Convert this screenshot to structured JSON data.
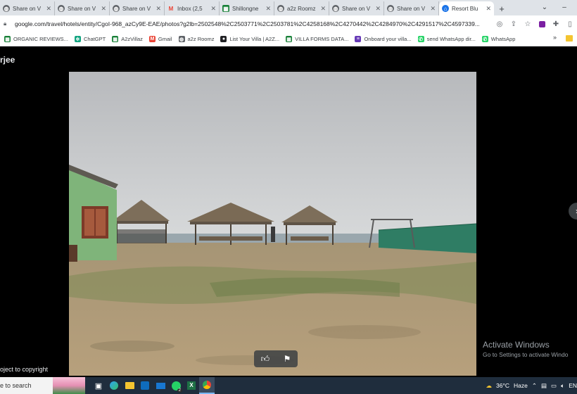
{
  "browser": {
    "tabs": [
      {
        "title": "Share on V",
        "icon": "globe-icon",
        "active": false
      },
      {
        "title": "Share on V",
        "icon": "globe-icon",
        "active": false
      },
      {
        "title": "Share on V",
        "icon": "globe-icon",
        "active": false
      },
      {
        "title": "Inbox (2,5",
        "icon": "gmail-icon",
        "active": false
      },
      {
        "title": "Shillongne",
        "icon": "sheets-icon",
        "active": false
      },
      {
        "title": "a2z Roomz",
        "icon": "globe-icon",
        "active": false
      },
      {
        "title": "Share on V",
        "icon": "globe-icon",
        "active": false
      },
      {
        "title": "Share on V",
        "icon": "globe-icon",
        "active": false
      },
      {
        "title": "Resort Blu",
        "icon": "hotel-icon",
        "active": true
      }
    ],
    "new_tab": "+",
    "url": "google.com/travel/hotels/entity/CgoI-968_azCy9E-EAE/photos?g2lb=2502548%2C2503771%2C2503781%2C4258168%2C4270442%2C4284970%2C4291517%2C4597339...",
    "bookmarks": [
      {
        "label": "ORGANIC REVIEWS...",
        "icon": "sheets-icon",
        "color": "#188038"
      },
      {
        "label": "ChatGPT",
        "icon": "chatgpt-icon",
        "color": "#10a37f"
      },
      {
        "label": "A2zVillaz",
        "icon": "sheets-icon",
        "color": "#188038"
      },
      {
        "label": "Gmail",
        "icon": "gmail-icon",
        "color": "#ea4335"
      },
      {
        "label": "a2z Roomz",
        "icon": "globe-icon",
        "color": "#5f6368"
      },
      {
        "label": "List Your Villa | A2Z...",
        "icon": "circle-icon",
        "color": "#202124"
      },
      {
        "label": "VILLA FORMS DATA...",
        "icon": "sheets-icon",
        "color": "#188038"
      },
      {
        "label": "Onboard your villa...",
        "icon": "forms-icon",
        "color": "#673ab7"
      },
      {
        "label": "send WhatsApp dir...",
        "icon": "whatsapp-icon",
        "color": "#25d366"
      },
      {
        "label": "WhatsApp",
        "icon": "whatsapp-icon",
        "color": "#25d366"
      }
    ]
  },
  "viewer": {
    "uploader_name": "rjee",
    "copyright_text": "oject to copyright",
    "like_icon": "thumbs-up-icon",
    "flag_icon": "flag-icon"
  },
  "watermark": {
    "title": "Activate Windows",
    "subtitle": "Go to Settings to activate Windo"
  },
  "taskbar": {
    "search_text": "e to search",
    "weather": "36°C",
    "weather_desc": "Haze",
    "tray_lang": "EN",
    "apps": [
      "task-view-icon",
      "edge-icon",
      "file-explorer-icon",
      "store-icon",
      "mail-icon",
      "whatsapp-icon",
      "excel-icon",
      "chrome-icon"
    ],
    "whatsapp_badge": "2"
  },
  "colors": {
    "tab_bar": "#dfe3e8",
    "viewer_bg": "#000000",
    "taskbar": "#1f2d3d"
  }
}
